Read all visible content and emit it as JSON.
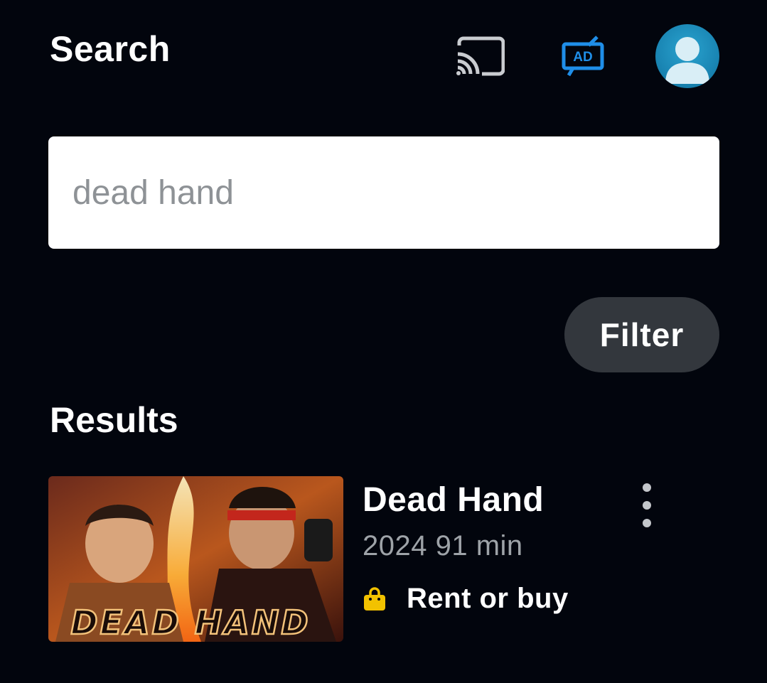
{
  "header": {
    "title": "Search",
    "icons": [
      "cast-icon",
      "audio-description-icon",
      "profile-avatar-icon"
    ],
    "ad_badge_text": "AD",
    "accent_color": "#1f8ee8"
  },
  "search": {
    "value": "",
    "placeholder": "dead hand"
  },
  "filter": {
    "label": "Filter"
  },
  "results": {
    "title": "Results",
    "items": [
      {
        "title": "Dead Hand",
        "meta": "2024 91 min",
        "offer": "Rent or buy",
        "offer_icon": "shopping-bag-icon",
        "offer_icon_color": "#f2c200",
        "thumbnail_text": "DEAD HAND",
        "more_icon": "more-vertical-icon"
      }
    ]
  }
}
